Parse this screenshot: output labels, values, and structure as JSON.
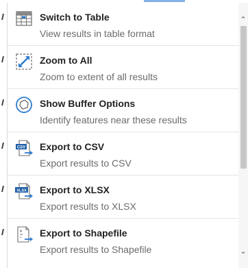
{
  "colors": {
    "accent": "#2b7bcf",
    "title_text": "#222222",
    "desc_text": "#6b6b6b",
    "divider": "#e4e4e4"
  },
  "menu": {
    "items": [
      {
        "icon": "table-icon",
        "title": "Switch to Table",
        "description": "View results in table format"
      },
      {
        "icon": "zoom-to-all-icon",
        "title": "Zoom to All",
        "description": "Zoom to extent of all results"
      },
      {
        "icon": "buffer-icon",
        "title": "Show Buffer Options",
        "description": "Identify features near these results"
      },
      {
        "icon": "csv-export-icon",
        "title": "Export to CSV",
        "description": "Export results to CSV",
        "badge": "CSV"
      },
      {
        "icon": "xlsx-export-icon",
        "title": "Export to XLSX",
        "description": "Export results to XLSX",
        "badge": "XLSX"
      },
      {
        "icon": "shapefile-export-icon",
        "title": "Export to Shapefile",
        "description": "Export results to Shapefile"
      }
    ]
  },
  "scrollbar": {
    "up_arrow": "⌃",
    "down_arrow": "⌄"
  }
}
